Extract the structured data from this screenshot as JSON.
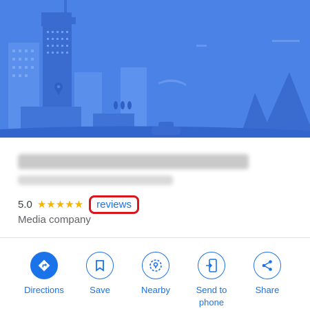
{
  "place": {
    "rating": "5.0",
    "stars": "★★★★★",
    "reviews_label": "reviews",
    "category": "Media company"
  },
  "actions": [
    {
      "label": "Directions",
      "icon": "directions-icon"
    },
    {
      "label": "Save",
      "icon": "bookmark-icon"
    },
    {
      "label": "Nearby",
      "icon": "nearby-icon"
    },
    {
      "label": "Send to phone",
      "icon": "send-to-phone-icon"
    },
    {
      "label": "Share",
      "icon": "share-icon"
    }
  ],
  "colors": {
    "hero_background": "#4a82e6",
    "accent": "#1a73e8",
    "star": "#f4b400",
    "highlight_border": "#d9161b"
  }
}
